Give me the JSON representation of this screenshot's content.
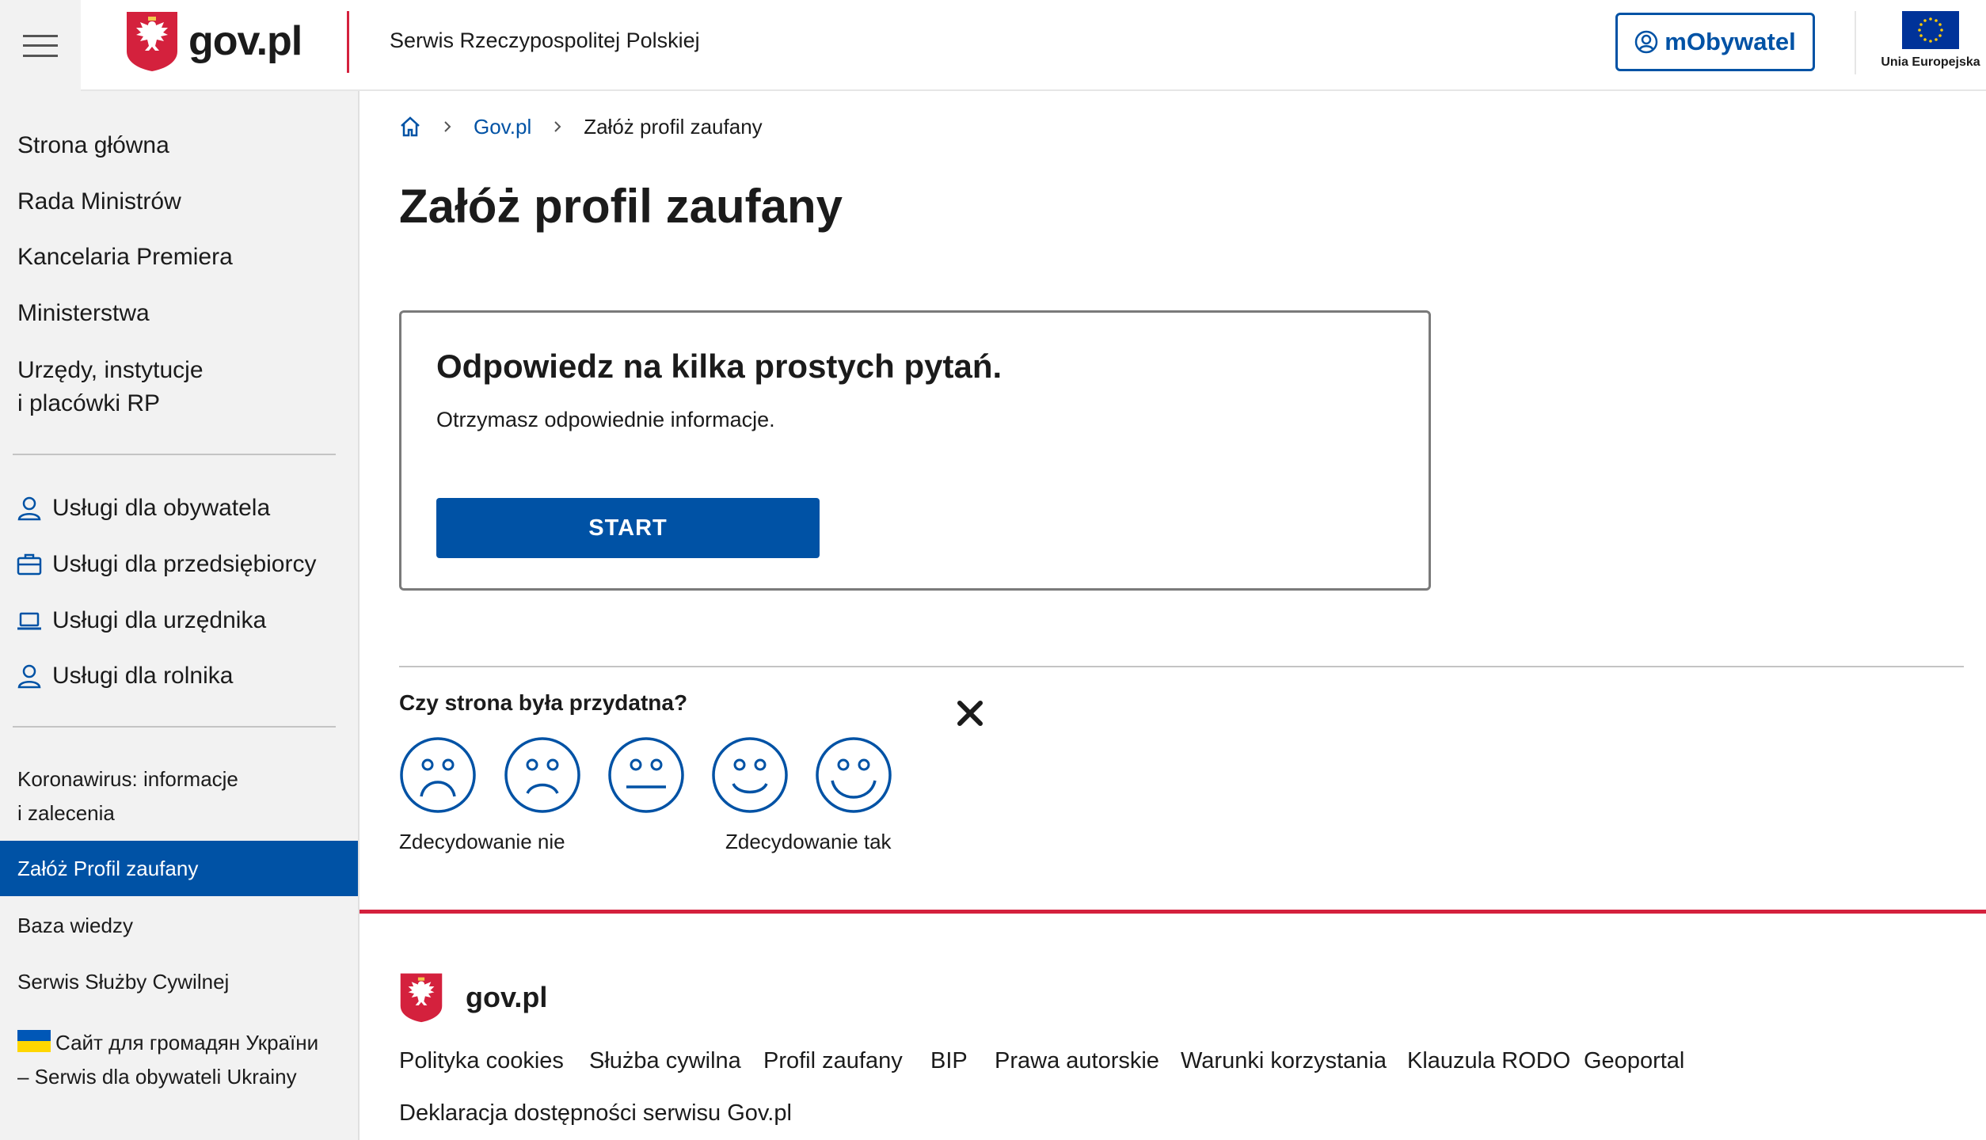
{
  "header": {
    "logo_text": "gov.pl",
    "service_name": "Serwis Rzeczypospolitej Polskiej",
    "mobywatel_label": "mObywatel",
    "eu_label": "Unia Europejska"
  },
  "sidebar": {
    "main_links": [
      "Strona główna",
      "Rada Ministrów",
      "Kancelaria Premiera",
      "Ministerstwa",
      "Urzędy, instytucje",
      "i placówki RP"
    ],
    "services": [
      "Usługi dla obywatela",
      "Usługi dla przedsiębiorcy",
      "Usługi dla urzędnika",
      "Usługi dla rolnika"
    ],
    "covid_line1": "Koronawirus: informacje",
    "covid_line2": "i zalecenia",
    "active_item": "Załóż Profil zaufany",
    "knowledge_base": "Baza wiedzy",
    "civil_service": "Serwis Służby Cywilnej",
    "ukraine_line1": "Сайт для громадян України",
    "ukraine_line2": "– Serwis dla obywateli Ukrainy"
  },
  "breadcrumb": {
    "home_icon": "home-icon",
    "items": [
      "Gov.pl",
      "Załóż profil zaufany"
    ]
  },
  "main": {
    "title": "Załóż profil zaufany",
    "card_title": "Odpowiedz na kilka prostych pytań.",
    "card_subtitle": "Otrzymasz odpowiednie informacje.",
    "start_label": "START"
  },
  "feedback": {
    "question": "Czy strona była przydatna?",
    "label_no": "Zdecydowanie nie",
    "label_yes": "Zdecydowanie tak",
    "faces": [
      "very-sad-face-icon",
      "sad-face-icon",
      "neutral-face-icon",
      "happy-face-icon",
      "very-happy-face-icon"
    ]
  },
  "footer": {
    "logo_text": "gov.pl",
    "links": [
      "Polityka cookies",
      "Służba cywilna",
      "Profil zaufany",
      "BIP",
      "Prawa autorskie",
      "Warunki korzystania",
      "Klauzula RODO",
      "Geoportal"
    ],
    "accessibility": "Deklaracja dostępności serwisu Gov.pl"
  },
  "colors": {
    "primary_blue": "#0052a5",
    "accent_red": "#d4213d",
    "sidebar_bg": "#f2f2f2"
  }
}
